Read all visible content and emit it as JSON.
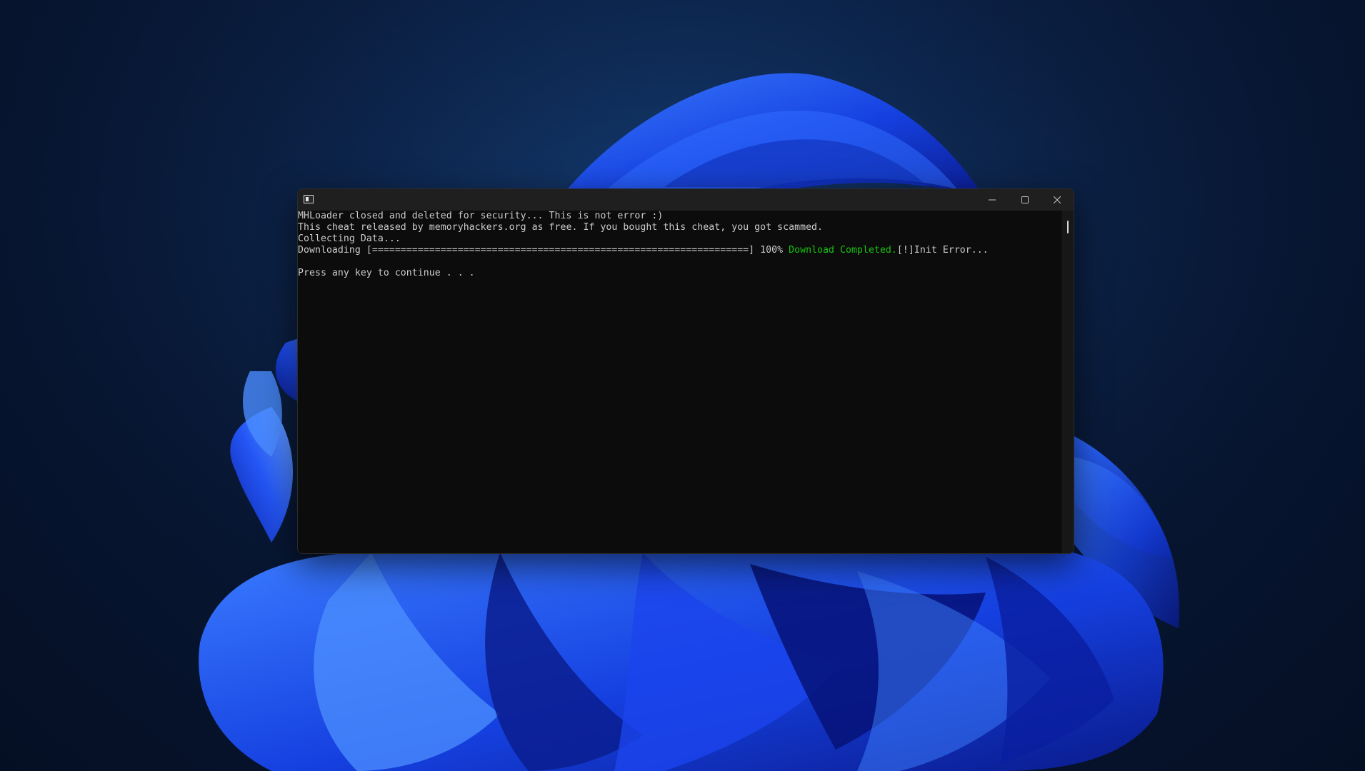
{
  "window": {
    "title": "",
    "icon": "console-app-icon",
    "caption_buttons": [
      "minimize-icon",
      "maximize-icon",
      "close-icon"
    ]
  },
  "console": {
    "lines": [
      "MHLoader closed and deleted for security... This is not error :)",
      "This cheat released by memoryhackers.org as free. If you bought this cheat, you got scammed.",
      "Collecting Data...",
      "",
      "",
      "Press any key to continue . . ."
    ],
    "download_line": {
      "prefix": "Downloading [==================================================================] 100% ",
      "status": "Download Completed.",
      "suffix": "[!]Init Error..."
    },
    "progress": 100
  },
  "colors": {
    "console_background": "#0c0c0c",
    "console_text": "#cccccc",
    "success_text": "#16c60c",
    "title_bar": "#1f1f1f"
  }
}
